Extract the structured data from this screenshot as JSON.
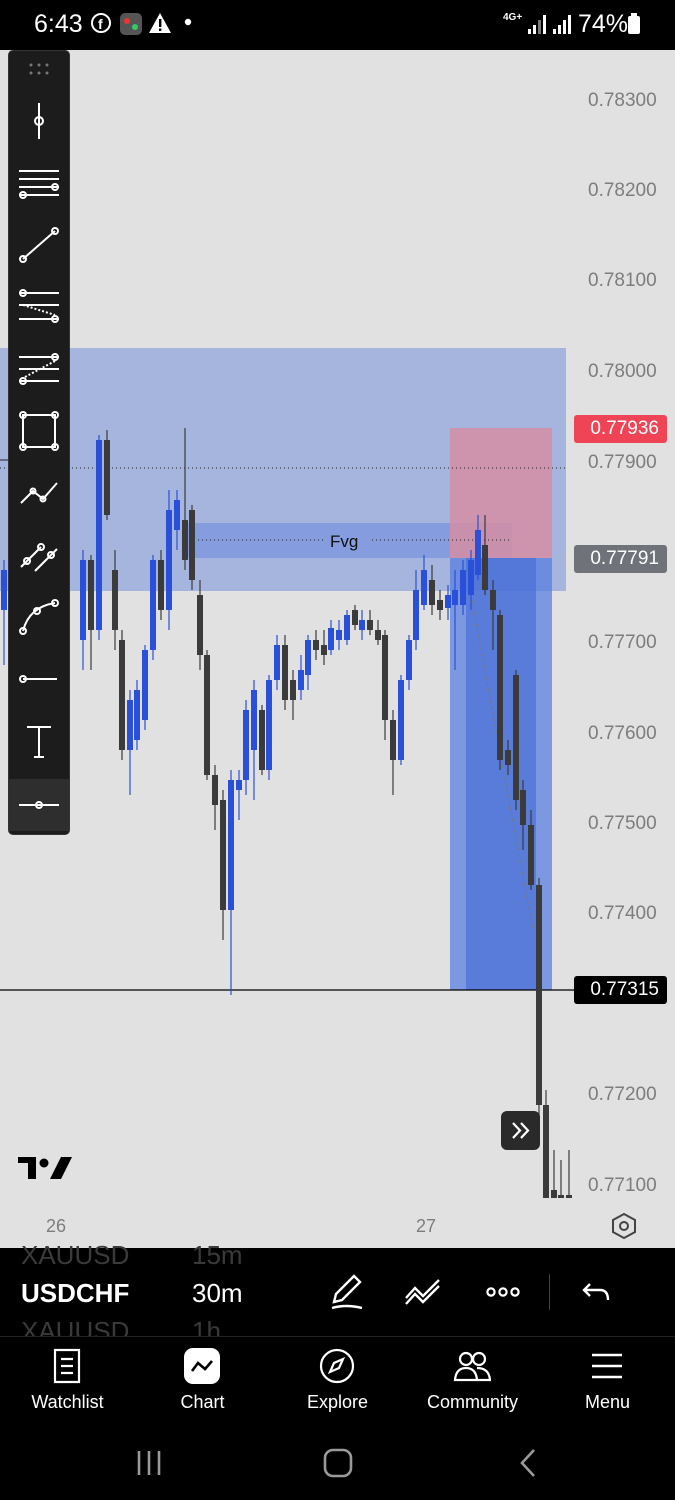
{
  "status_bar": {
    "time": "6:43",
    "network": "4G+",
    "battery": "74%"
  },
  "chart": {
    "symbol": "USDCHF",
    "timeframe": "30m",
    "price_scale": [
      "0.78300",
      "0.78200",
      "0.78100",
      "0.78000",
      "0.77900",
      "0.77700",
      "0.77600",
      "0.77500",
      "0.77400",
      "0.77200",
      "0.77100"
    ],
    "price_tags": {
      "stop": "0.77936",
      "entry": "0.77791",
      "last": "0.77315"
    },
    "annotation": "Fvg",
    "time_labels": [
      "26",
      "27"
    ],
    "colors": {
      "up": "#2a4fd8",
      "down": "#3b3b3b",
      "zone": "#8ea4db",
      "stop_zone": "#d58ea4",
      "target_zone": "#5a7fe0",
      "last_tag": "#000000",
      "stop_tag": "#ef4455",
      "entry_tag": "#6f7379"
    }
  },
  "drawing_tools": [
    "cursor",
    "horizontal-lines",
    "trend-line",
    "fib-retracement",
    "fib-extension",
    "rectangle",
    "path",
    "parallel-channel",
    "curve",
    "horizontal-ray",
    "text",
    "horizontal-line"
  ],
  "symbol_bar": {
    "prev_symbol": "XAUUSD",
    "prev_tf": "15m",
    "symbol": "USDCHF",
    "tf": "30m",
    "next_symbol": "XAUUSD",
    "next_tf": "1h"
  },
  "bottom_nav": [
    {
      "label": "Watchlist",
      "icon": "watchlist-icon"
    },
    {
      "label": "Chart",
      "icon": "chart-icon"
    },
    {
      "label": "Explore",
      "icon": "compass-icon"
    },
    {
      "label": "Community",
      "icon": "community-icon"
    },
    {
      "label": "Menu",
      "icon": "menu-icon"
    }
  ]
}
